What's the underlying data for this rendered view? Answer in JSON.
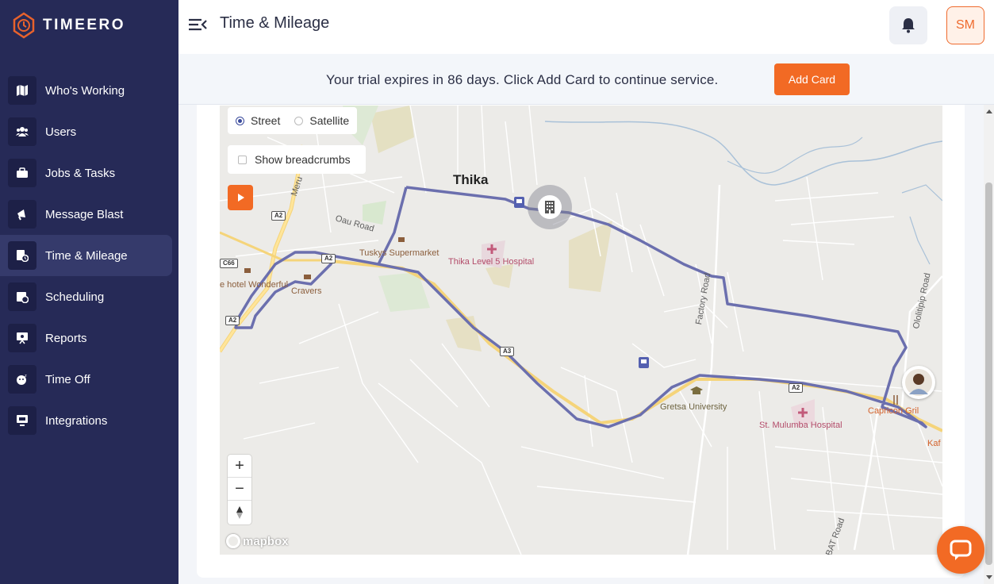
{
  "app": {
    "name": "TIMEERO",
    "logo_icon": "timeero-logo-icon"
  },
  "sidebar": {
    "items": [
      {
        "label": "Who's Working",
        "icon": "map-icon",
        "active": false
      },
      {
        "label": "Users",
        "icon": "users-icon",
        "active": false
      },
      {
        "label": "Jobs & Tasks",
        "icon": "briefcase-icon",
        "active": false
      },
      {
        "label": "Message Blast",
        "icon": "megaphone-icon",
        "active": false
      },
      {
        "label": "Time & Mileage",
        "icon": "timesheet-icon",
        "active": true
      },
      {
        "label": "Scheduling",
        "icon": "calendar-icon",
        "active": false
      },
      {
        "label": "Reports",
        "icon": "reports-icon",
        "active": false
      },
      {
        "label": "Time Off",
        "icon": "time-off-icon",
        "active": false
      },
      {
        "label": "Integrations",
        "icon": "integrations-icon",
        "active": false
      }
    ]
  },
  "header": {
    "title": "Time & Mileage",
    "avatar_initials": "SM",
    "notification_icon": "bell-icon",
    "menu_icon": "menu-collapse-icon"
  },
  "banner": {
    "text": "Your trial expires in 86 days. Click Add Card to continue service.",
    "button_label": "Add Card"
  },
  "map": {
    "layer_options": [
      {
        "label": "Street",
        "selected": true
      },
      {
        "label": "Satellite",
        "selected": false
      }
    ],
    "breadcrumbs_label": "Show breadcrumbs",
    "breadcrumbs_checked": false,
    "zoom_in": "+",
    "zoom_out": "−",
    "compass": "compass-icon",
    "attribution": "mapbox",
    "labels": {
      "city": "Thika",
      "oau_road": "Oau Road",
      "tuskys": "Tuskys Supermarket",
      "thika_hospital": "Thika Level 5 Hospital",
      "hotel": "e hotel Wonderful",
      "cravers": "Cravers",
      "factory_road": "Factory Road",
      "gretsa": "Gretsa University",
      "st_mulumba": "St. Mulumba Hospital",
      "capricon": "Capricon Gril",
      "kaf": "Kaf",
      "ololitipip": "Ololitipip Road",
      "bat_road": "BAT Road",
      "meru": "Meru"
    },
    "shields": {
      "a2_top": "A2",
      "c66": "C66",
      "a2_left": "A2",
      "a2_mid": "A2",
      "a3": "A3",
      "a2_right": "A2"
    },
    "route_color": "#6b6fae",
    "accent_color": "#f26a24"
  }
}
